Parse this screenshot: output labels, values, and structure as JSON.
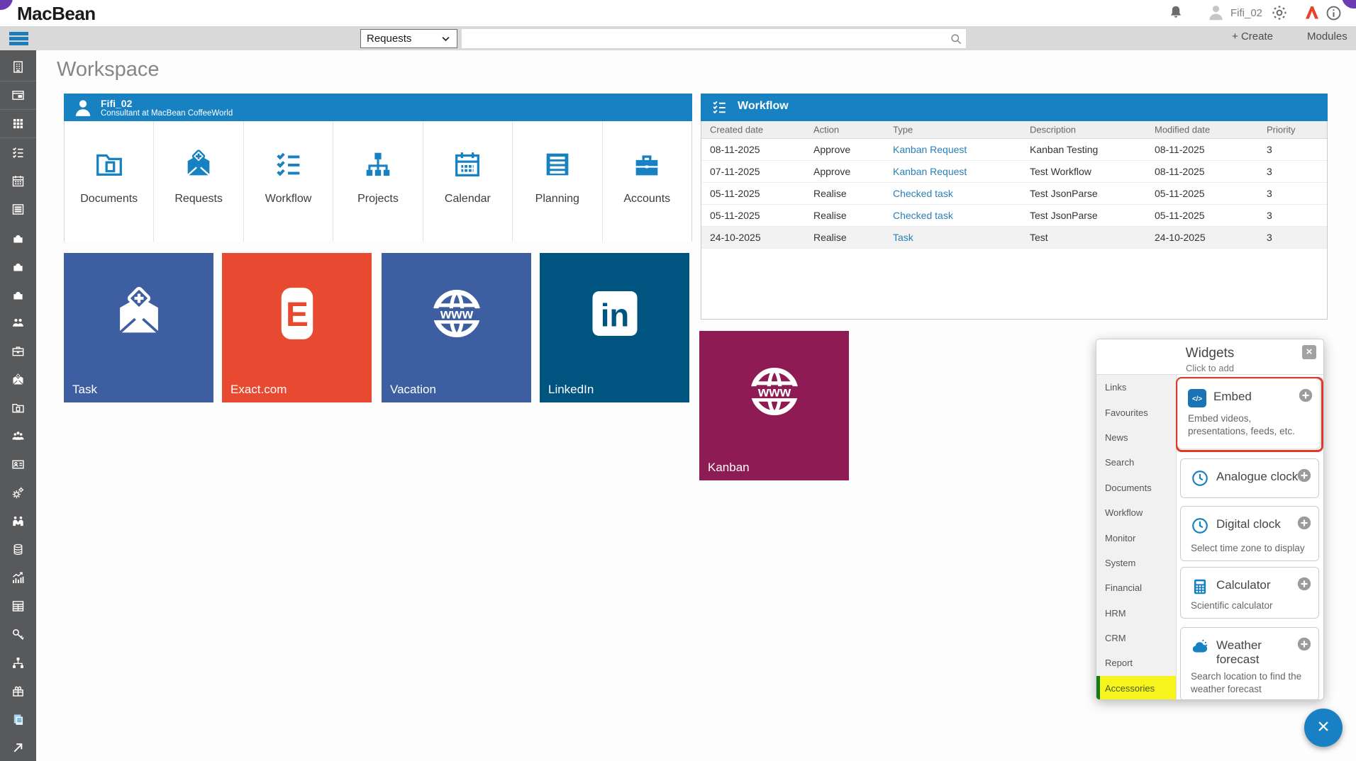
{
  "brand": "MacBean",
  "topbar": {
    "user_name": "Fifi_02",
    "create_label": "Create",
    "create_plus": "+",
    "modules_label": "Modules",
    "filter_value": "Requests",
    "search_value": ""
  },
  "page": {
    "title": "Workspace"
  },
  "profile": {
    "name": "Fifi_02",
    "role": "Consultant at MacBean CoffeeWorld",
    "shortcuts": [
      {
        "label": "Documents",
        "icon": "documents-folder-icon"
      },
      {
        "label": "Requests",
        "icon": "request-envelope-icon"
      },
      {
        "label": "Workflow",
        "icon": "workflow-checklist-icon"
      },
      {
        "label": "Projects",
        "icon": "projects-orgchart-icon"
      },
      {
        "label": "Calendar",
        "icon": "calendar-icon"
      },
      {
        "label": "Planning",
        "icon": "planning-list-icon"
      },
      {
        "label": "Accounts",
        "icon": "accounts-briefcase-icon"
      }
    ]
  },
  "tiles": [
    {
      "label": "Task",
      "icon": "task-envelope-icon",
      "color": "#3d5fa1"
    },
    {
      "label": "Exact.com",
      "icon": "exact-logo",
      "color": "#e84a31"
    },
    {
      "label": "Vacation",
      "icon": "globe-www-icon",
      "color": "#3d5fa1"
    },
    {
      "label": "LinkedIn",
      "icon": "linkedin-logo",
      "color": "#005480"
    },
    {
      "label": "Kanban",
      "icon": "globe-www-icon",
      "color": "#8e1b53"
    }
  ],
  "workflow": {
    "title": "Workflow",
    "columns": [
      "Created date",
      "Action",
      "Type",
      "Description",
      "Modified date",
      "Priority"
    ],
    "rows": [
      {
        "created": "08-11-2025",
        "action": "Approve",
        "type": "Kanban Request",
        "description": "Kanban Testing",
        "modified": "08-11-2025",
        "priority": "3"
      },
      {
        "created": "07-11-2025",
        "action": "Approve",
        "type": "Kanban Request",
        "description": "Test Workflow",
        "modified": "08-11-2025",
        "priority": "3"
      },
      {
        "created": "05-11-2025",
        "action": "Realise",
        "type": "Checked task",
        "description": "Test JsonParse",
        "modified": "05-11-2025",
        "priority": "3"
      },
      {
        "created": "05-11-2025",
        "action": "Realise",
        "type": "Checked task",
        "description": "Test JsonParse",
        "modified": "05-11-2025",
        "priority": "3"
      },
      {
        "created": "24-10-2025",
        "action": "Realise",
        "type": "Task",
        "description": "Test",
        "modified": "24-10-2025",
        "priority": "3"
      }
    ]
  },
  "widgets": {
    "title": "Widgets",
    "subtitle": "Click to add",
    "categories": [
      "Links",
      "Favourites",
      "News",
      "Search",
      "Documents",
      "Workflow",
      "Monitor",
      "System",
      "Financial",
      "HRM",
      "CRM",
      "Report",
      "Accessories"
    ],
    "selected_category": "Accessories",
    "items": [
      {
        "name": "Embed",
        "description": "Embed videos, presentations, feeds, etc.",
        "icon": "code-icon",
        "highlighted": true
      },
      {
        "name": "Analogue clock",
        "description": "",
        "icon": "clock-icon"
      },
      {
        "name": "Digital clock",
        "description": "Select time zone to display",
        "icon": "clock-icon"
      },
      {
        "name": "Calculator",
        "description": "Scientific calculator",
        "icon": "calculator-icon"
      },
      {
        "name": "Weather forecast",
        "description": "Search location to find the weather forecast",
        "icon": "weather-cloud-icon"
      }
    ]
  },
  "sidebar": {
    "icons": [
      "company",
      "insite-browser",
      "apps-grid",
      "workflow-checklist",
      "calendar",
      "planning-list",
      "connector-puzzle-1",
      "connector-puzzle-2",
      "connector-puzzle-3",
      "cooperation-people",
      "organisation-briefcase",
      "task-envelope",
      "dossier-folder",
      "employees-group",
      "contact-card",
      "settings-gears",
      "partners-handshake",
      "financial-coins",
      "statistics-chart",
      "forms-table",
      "authorisation-key",
      "structure-orgchart",
      "promotions-gift",
      "news-documents",
      "external-link"
    ]
  },
  "colors": {
    "accent_blue": "#1781c2",
    "tile_blue": "#3d5fa1",
    "exact_red": "#e84a31",
    "linkedin_navy": "#005480",
    "kanban_maroon": "#8e1b53",
    "highlight_red": "#e0392b",
    "highlight_yellow": "#f7f41c",
    "link_blue": "#2980b9",
    "sidebar_gray": "#58595b"
  }
}
